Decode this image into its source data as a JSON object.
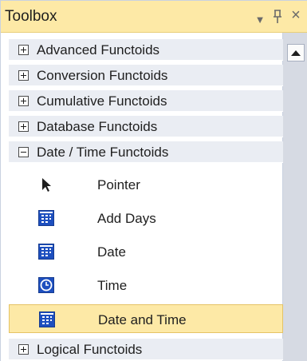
{
  "window": {
    "title": "Toolbox",
    "buttons": {
      "menu_icon": "dropdown-arrow",
      "pin_icon": "pin",
      "close_icon": "close"
    }
  },
  "categories_top": [
    {
      "label": "Advanced Functoids",
      "state": "collapsed"
    },
    {
      "label": "Conversion Functoids",
      "state": "collapsed"
    },
    {
      "label": "Cumulative Functoids",
      "state": "collapsed"
    },
    {
      "label": "Database Functoids",
      "state": "collapsed"
    },
    {
      "label": "Date / Time Functoids",
      "state": "expanded"
    }
  ],
  "items": [
    {
      "label": "Pointer",
      "icon": "pointer-arrow",
      "selected": false
    },
    {
      "label": "Add Days",
      "icon": "calendar-add",
      "selected": false
    },
    {
      "label": "Date",
      "icon": "calendar-grid",
      "selected": false
    },
    {
      "label": "Time",
      "icon": "clock",
      "selected": false
    },
    {
      "label": "Date and Time",
      "icon": "calendar-clock",
      "selected": true
    }
  ],
  "categories_bottom": [
    {
      "label": "Logical Functoids",
      "state": "collapsed"
    }
  ],
  "colors": {
    "title_background": "#fde9a6",
    "selection_background": "#fde9a6",
    "category_background": "#eaedf3",
    "icon_blue": "#1d4fbf"
  }
}
